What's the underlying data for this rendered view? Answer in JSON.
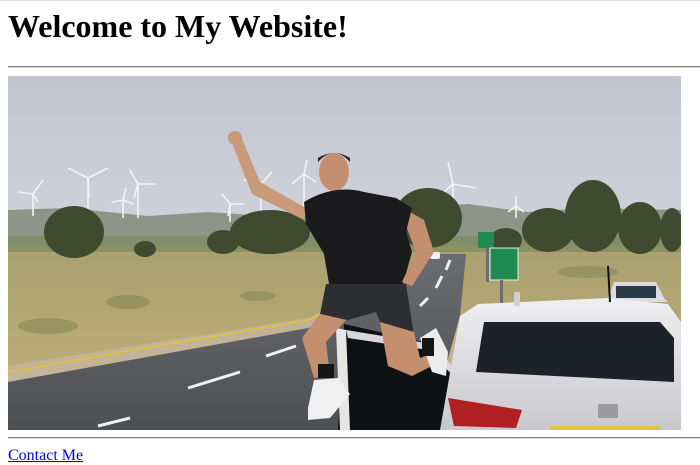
{
  "page": {
    "heading": "Welcome to My Website!",
    "contact_link": "Contact Me"
  },
  "photo": {
    "description_icon": "photo-man-jumping-roadside-wind-turbines",
    "road_sign_lines": [
      "",
      ""
    ]
  },
  "colors": {
    "link": "#0000ee",
    "sky": "#c3c7d2",
    "field": "#b9a86a",
    "road": "#5d5f62",
    "car": "#e4e4e6",
    "shirt": "#1b1b1d"
  }
}
